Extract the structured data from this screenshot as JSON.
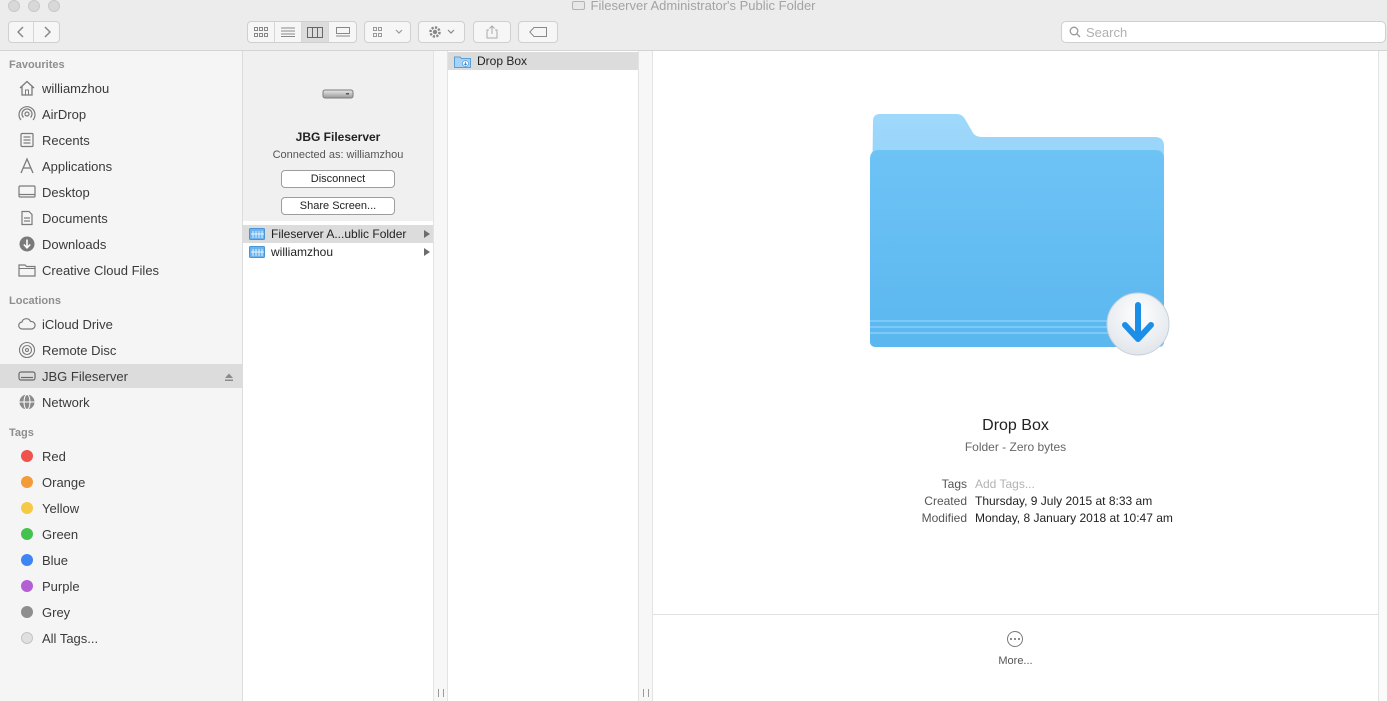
{
  "window": {
    "title": "Fileserver Administrator's Public Folder"
  },
  "toolbar": {
    "back_icon": "chevron-left-icon",
    "forward_icon": "chevron-right-icon",
    "view_modes": [
      "icon-view-icon",
      "list-view-icon",
      "column-view-icon",
      "gallery-view-icon"
    ],
    "active_view": "column",
    "search_placeholder": "Search"
  },
  "sidebar": {
    "favourites_header": "Favourites",
    "favourites": [
      {
        "label": "williamzhou",
        "icon": "home-icon"
      },
      {
        "label": "AirDrop",
        "icon": "airdrop-icon"
      },
      {
        "label": "Recents",
        "icon": "recents-icon"
      },
      {
        "label": "Applications",
        "icon": "applications-icon"
      },
      {
        "label": "Desktop",
        "icon": "desktop-icon"
      },
      {
        "label": "Documents",
        "icon": "documents-icon"
      },
      {
        "label": "Downloads",
        "icon": "downloads-icon"
      },
      {
        "label": "Creative Cloud Files",
        "icon": "folder-icon"
      }
    ],
    "locations_header": "Locations",
    "locations": [
      {
        "label": "iCloud Drive",
        "icon": "cloud-icon"
      },
      {
        "label": "Remote Disc",
        "icon": "disc-icon"
      },
      {
        "label": "JBG Fileserver",
        "icon": "server-icon",
        "selected": true
      },
      {
        "label": "Network",
        "icon": "network-icon"
      }
    ],
    "tags_header": "Tags",
    "tags": [
      {
        "label": "Red",
        "color": "#f0524c"
      },
      {
        "label": "Orange",
        "color": "#f29b38"
      },
      {
        "label": "Yellow",
        "color": "#f6c944"
      },
      {
        "label": "Green",
        "color": "#45c150"
      },
      {
        "label": "Blue",
        "color": "#3d84f5"
      },
      {
        "label": "Purple",
        "color": "#b55fd4"
      },
      {
        "label": "Grey",
        "color": "#8e8e8e"
      },
      {
        "label": "All Tags...",
        "color": "#e0e0e0"
      }
    ]
  },
  "server_panel": {
    "name": "JBG Fileserver",
    "connected_as": "Connected as: williamzhou",
    "disconnect_label": "Disconnect",
    "share_screen_label": "Share Screen..."
  },
  "column1": {
    "items": [
      {
        "label": "Fileserver A...ublic Folder",
        "selected": true
      },
      {
        "label": "williamzhou",
        "selected": false
      }
    ]
  },
  "column2": {
    "items": [
      {
        "label": "Drop Box",
        "selected": true
      }
    ]
  },
  "preview": {
    "name": "Drop Box",
    "kind": "Folder - Zero bytes",
    "tags_label": "Tags",
    "tags_placeholder": "Add Tags...",
    "created_label": "Created",
    "created_value": "Thursday, 9 July 2015 at 8:33 am",
    "modified_label": "Modified",
    "modified_value": "Monday, 8 January 2018 at 10:47 am",
    "more_label": "More..."
  }
}
